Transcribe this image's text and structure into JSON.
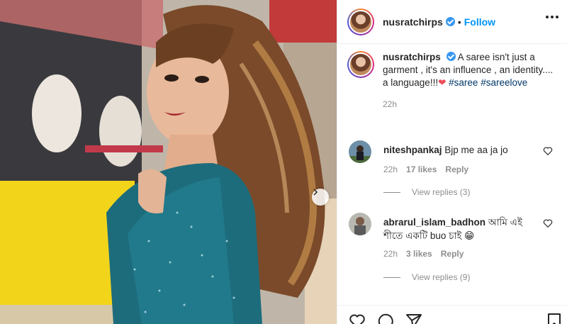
{
  "post": {
    "username": "nusratchirps",
    "follow_label": "Follow",
    "separator": "•",
    "caption": {
      "text": "A saree isn't just a garment , it's an influence , an identity.... a language!!!",
      "heart": "❤",
      "hashtags": [
        "#saree",
        "#sareelove"
      ],
      "time": "22h"
    }
  },
  "comments": [
    {
      "username": "niteshpankaj",
      "text": "Bjp me aa ja jo",
      "time": "22h",
      "likes": "17 likes",
      "reply_label": "Reply",
      "view_replies": "View replies (3)"
    },
    {
      "username": "abrarul_islam_badhon",
      "text": "আমি এই শীতে একটি buo চাই 😁",
      "time": "22h",
      "likes": "3 likes",
      "reply_label": "Reply",
      "view_replies": "View replies (9)"
    }
  ],
  "icons": {
    "verified": "verified-badge-icon",
    "more": "more-options-icon",
    "like": "heart-icon",
    "comment": "comment-icon",
    "share": "share-icon",
    "save": "bookmark-icon",
    "carousel_next": "chevron-right-icon"
  },
  "colors": {
    "accent": "#0095f6",
    "hashtag": "#00376b",
    "heart": "#ed4956",
    "muted": "#8e8e8e",
    "verified": "#3897f0"
  }
}
